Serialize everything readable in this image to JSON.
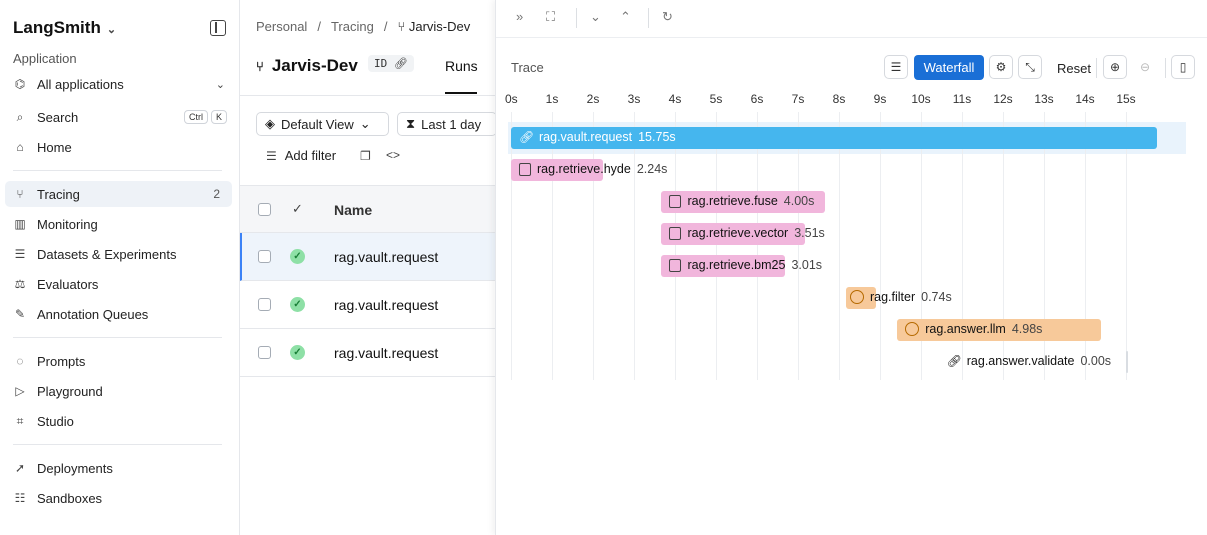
{
  "sidebar": {
    "brand": "LangSmith",
    "section_label": "Application",
    "app_select": "All applications",
    "search": {
      "label": "Search",
      "kbd1": "Ctrl",
      "kbd2": "K"
    },
    "home": "Home",
    "items": [
      {
        "label": "Tracing",
        "count": "2",
        "icon": "tracing-icon"
      },
      {
        "label": "Monitoring",
        "icon": "monitoring-icon"
      },
      {
        "label": "Datasets & Experiments",
        "icon": "datasets-icon"
      },
      {
        "label": "Evaluators",
        "icon": "evaluators-icon"
      },
      {
        "label": "Annotation Queues",
        "icon": "annotation-icon"
      }
    ],
    "items2": [
      {
        "label": "Prompts",
        "icon": "prompts-icon"
      },
      {
        "label": "Playground",
        "icon": "playground-icon"
      },
      {
        "label": "Studio",
        "icon": "studio-icon"
      }
    ],
    "items3": [
      {
        "label": "Deployments",
        "icon": "deployments-icon"
      },
      {
        "label": "Sandboxes",
        "icon": "sandboxes-icon"
      }
    ]
  },
  "middle": {
    "breadcrumb": [
      "Personal",
      "/",
      "Tracing",
      "/",
      "Jarvis-Dev"
    ],
    "project_title": "Jarvis-Dev",
    "id_chip": "ID",
    "tab": "Runs",
    "view_select": "Default View",
    "time_select": "Last 1 day",
    "add_filter": "Add filter",
    "column_name": "Name",
    "rows": [
      {
        "name": "rag.vault.request",
        "selected": true
      },
      {
        "name": "rag.vault.request",
        "selected": false
      },
      {
        "name": "rag.vault.request",
        "selected": false
      }
    ]
  },
  "trace": {
    "title": "Trace",
    "waterfall": "Waterfall",
    "reset": "Reset",
    "ticks": [
      "0s",
      "1s",
      "2s",
      "3s",
      "4s",
      "5s",
      "6s",
      "7s",
      "8s",
      "9s",
      "10s",
      "11s",
      "12s",
      "13s",
      "14s",
      "15s"
    ],
    "spans": [
      {
        "name": "rag.vault.request",
        "duration": "15.75s",
        "start": 0.0,
        "length": 15.75,
        "color": "#45b6ee",
        "icon": "link-icon",
        "text_color": "#ffffff"
      },
      {
        "name": "rag.retrieve.hyde",
        "duration": "2.24s",
        "start": 0.0,
        "length": 2.24,
        "color": "#f1b6dc",
        "icon": "document-icon"
      },
      {
        "name": "rag.retrieve.fuse",
        "duration": "4.00s",
        "start": 3.67,
        "length": 4.0,
        "color": "#f1b6dc",
        "icon": "document-icon"
      },
      {
        "name": "rag.retrieve.vector",
        "duration": "3.51s",
        "start": 3.67,
        "length": 3.51,
        "color": "#f1b6dc",
        "icon": "document-icon"
      },
      {
        "name": "rag.retrieve.bm25",
        "duration": "3.01s",
        "start": 3.67,
        "length": 3.01,
        "color": "#f1b6dc",
        "icon": "document-icon"
      },
      {
        "name": "rag.filter",
        "duration": "0.74s",
        "start": 8.17,
        "length": 0.74,
        "color": "#f7c99a",
        "icon": "llm-icon"
      },
      {
        "name": "rag.answer.llm",
        "duration": "4.98s",
        "start": 9.42,
        "length": 4.98,
        "color": "#f7c99a",
        "icon": "llm-icon"
      },
      {
        "name": "rag.answer.validate",
        "duration": "0.00s",
        "start": 14.97,
        "length": 0.0,
        "color": "#ffffff",
        "icon": "link-icon"
      }
    ]
  }
}
